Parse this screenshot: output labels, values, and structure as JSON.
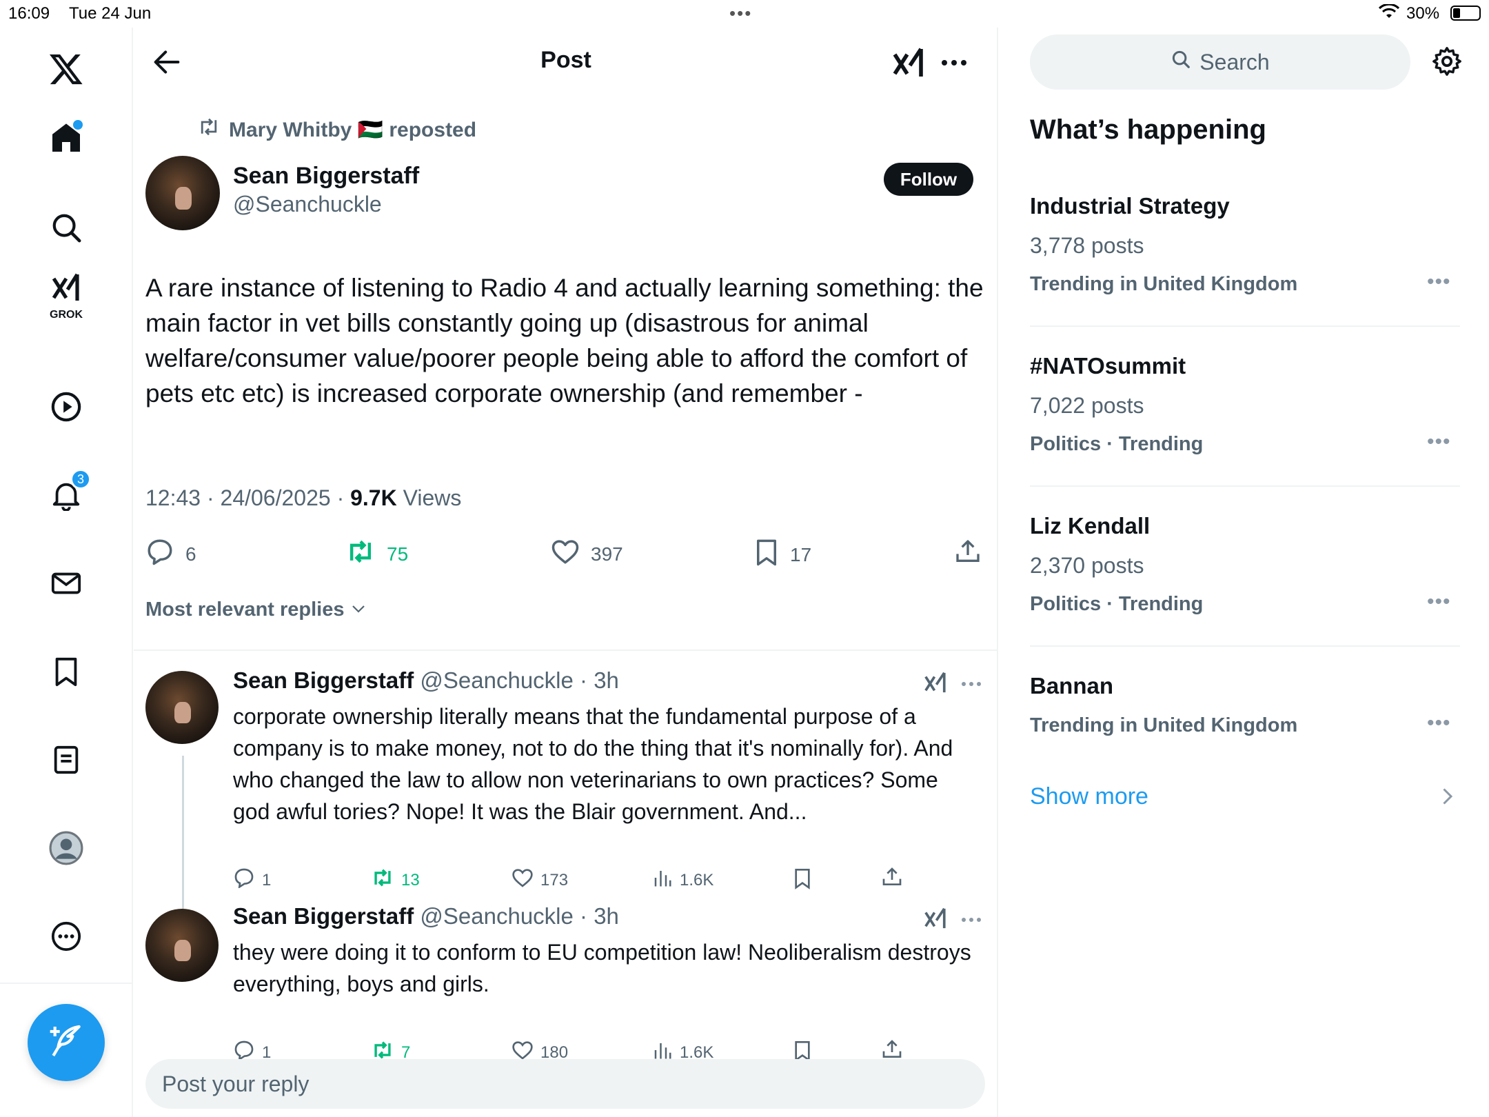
{
  "status_bar": {
    "time": "16:09",
    "date": "Tue 24 Jun",
    "battery": "30%"
  },
  "nav": {
    "grok_label": "GROK",
    "notifications_badge": "3"
  },
  "header": {
    "title": "Post"
  },
  "post": {
    "repost_label": "Mary Whitby 🇵🇸 reposted",
    "author_name": "Sean Biggerstaff",
    "author_handle": "@Seanchuckle",
    "follow_label": "Follow",
    "text": "A rare instance of listening to Radio 4 and actually learning something: the main factor in vet bills constantly going up (disastrous for animal welfare/consumer value/poorer people being able to afford the comfort of pets etc etc) is increased corporate ownership (and remember -",
    "timestamp": "12:43 · 24/06/2025 · ",
    "views_count": "9.7K",
    "views_label": " Views",
    "replies": "6",
    "reposts": "75",
    "likes": "397",
    "bookmarks": "17",
    "sort_label": "Most relevant replies"
  },
  "replies": [
    {
      "author_name": "Sean Biggerstaff",
      "meta": " @Seanchuckle · 3h",
      "text": "corporate ownership literally means that the fundamental purpose of a company is to make money, not to do the thing that it's nominally for). And who changed the law to allow non veterinarians to own practices? Some god awful tories? Nope! It was the Blair government. And...",
      "replies": "1",
      "reposts": "13",
      "likes": "173",
      "views": "1.6K"
    },
    {
      "author_name": "Sean Biggerstaff",
      "meta": " @Seanchuckle · 3h",
      "text": "they were doing it to conform to EU competition law! Neoliberalism destroys everything, boys and girls.",
      "replies": "1",
      "reposts": "7",
      "likes": "180",
      "views": "1.6K"
    }
  ],
  "reply_box": {
    "placeholder": "Post your reply"
  },
  "sidebar": {
    "search_placeholder": "Search",
    "heading": "What’s happening",
    "trends": [
      {
        "title": "Industrial Strategy",
        "count": "3,778 posts",
        "context": "Trending in United Kingdom"
      },
      {
        "title": "#NATOsummit",
        "count": "7,022 posts",
        "context": "Politics · Trending"
      },
      {
        "title": "Liz Kendall",
        "count": "2,370 posts",
        "context": "Politics · Trending"
      },
      {
        "title": "Bannan",
        "count": "",
        "context": "Trending in United Kingdom"
      }
    ],
    "show_more": "Show more"
  },
  "colors": {
    "accent": "#1d9bf0",
    "repost_green": "#00ba7c",
    "secondary_text": "#536471"
  }
}
